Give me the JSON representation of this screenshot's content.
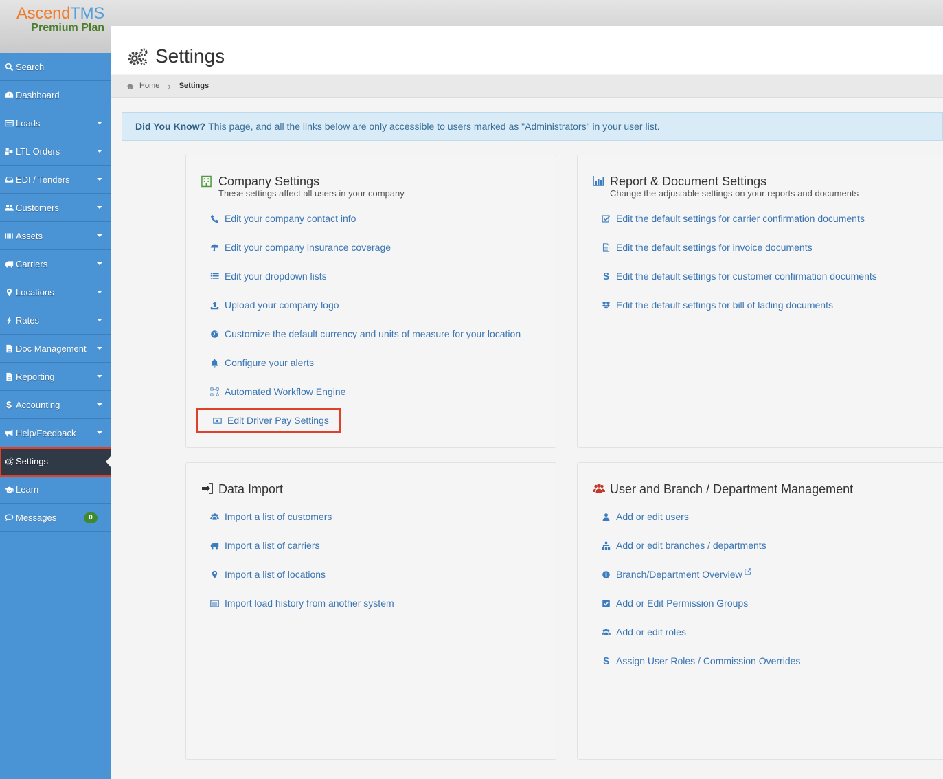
{
  "logo": {
    "brand_part1": "Ascend",
    "brand_part2": "TMS",
    "plan": "Premium Plan"
  },
  "colors": {
    "sidebar": "#4a94d6",
    "active": "#2f3a46",
    "link": "#3a75b4",
    "highlight": "#e0402a",
    "badge": "#3e8a2d"
  },
  "sidebar": {
    "items": [
      {
        "label": "Search",
        "icon": "search-icon"
      },
      {
        "label": "Dashboard",
        "icon": "dashboard-icon"
      },
      {
        "label": "Loads",
        "icon": "loads-icon"
      },
      {
        "label": "LTL Orders",
        "icon": "ltl-orders-icon"
      },
      {
        "label": "EDI / Tenders",
        "icon": "inbox-icon"
      },
      {
        "label": "Customers",
        "icon": "customers-icon"
      },
      {
        "label": "Assets",
        "icon": "barcode-icon"
      },
      {
        "label": "Carriers",
        "icon": "truck-icon"
      },
      {
        "label": "Locations",
        "icon": "map-marker-icon"
      },
      {
        "label": "Rates",
        "icon": "bolt-icon"
      },
      {
        "label": "Doc Management",
        "icon": "document-icon"
      },
      {
        "label": "Reporting",
        "icon": "report-icon"
      },
      {
        "label": "Accounting",
        "icon": "dollar-icon"
      },
      {
        "label": "Help/Feedback",
        "icon": "bullhorn-icon"
      },
      {
        "label": "Settings",
        "icon": "gears-icon"
      },
      {
        "label": "Learn",
        "icon": "graduation-cap-icon"
      },
      {
        "label": "Messages",
        "icon": "chat-icon"
      }
    ],
    "messages_badge": "0"
  },
  "header": {
    "title": "Settings"
  },
  "breadcrumb": {
    "home": "Home",
    "current": "Settings"
  },
  "alert": {
    "lead": "Did You Know?",
    "text": "This page, and all the links below are only accessible to users marked as \"Administrators\" in your user list."
  },
  "company_settings": {
    "title": "Company Settings",
    "subtitle": "These settings affect all users in your company",
    "links": [
      "Edit your company contact info",
      "Edit your company insurance coverage",
      "Edit your dropdown lists",
      "Upload your company logo",
      "Customize the default currency and units of measure for your location",
      "Configure your alerts",
      "Automated Workflow Engine",
      "Edit Driver Pay Settings"
    ]
  },
  "report_settings": {
    "title": "Report & Document Settings",
    "subtitle": "Change the adjustable settings on your reports and documents",
    "links": [
      "Edit the default settings for carrier confirmation documents",
      "Edit the default settings for invoice documents",
      "Edit the default settings for customer confirmation documents",
      "Edit the default settings for bill of lading documents"
    ]
  },
  "data_import": {
    "title": "Data Import",
    "links": [
      "Import a list of customers",
      "Import a list of carriers",
      "Import a list of locations",
      "Import load history from another system"
    ]
  },
  "user_management": {
    "title": "User and Branch / Department Management",
    "links": [
      "Add or edit users",
      "Add or edit branches / departments",
      "Branch/Department Overview",
      "Add or Edit Permission Groups",
      "Add or edit roles",
      "Assign User Roles / Commission Overrides"
    ]
  }
}
